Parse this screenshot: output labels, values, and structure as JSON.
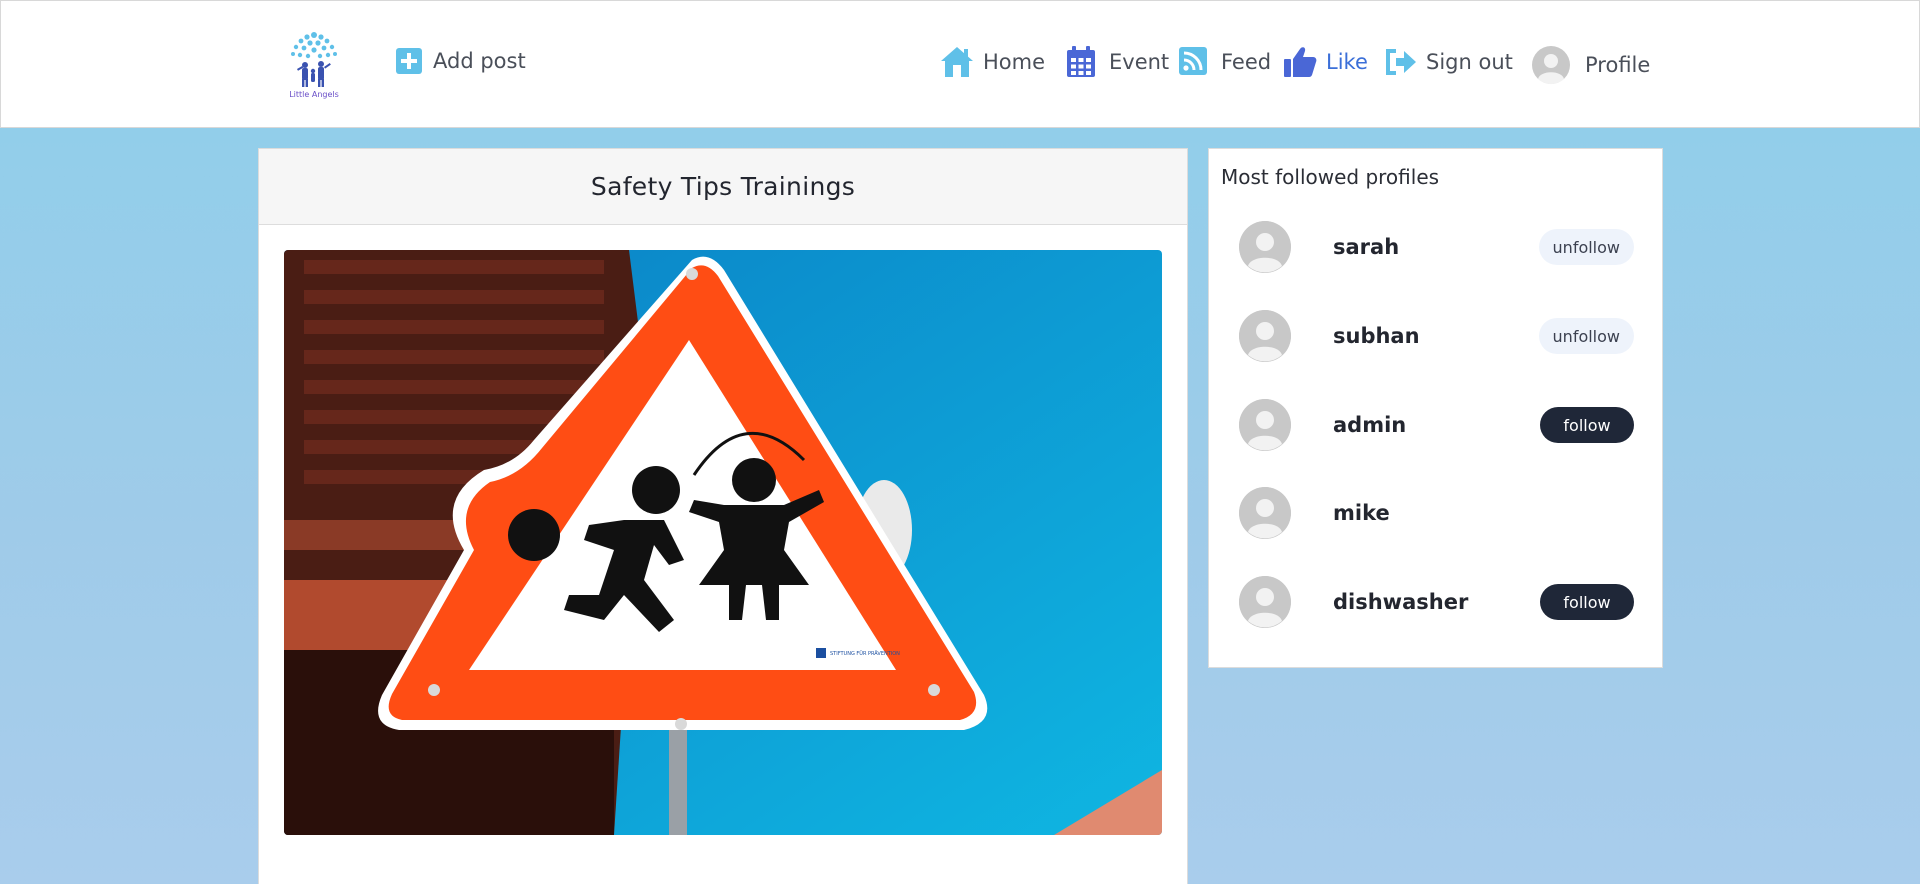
{
  "header": {
    "logo_text": "Little Angels",
    "add_post_label": "Add post",
    "nav": [
      {
        "label": "Home",
        "icon": "home-icon"
      },
      {
        "label": "Event",
        "icon": "calendar-icon"
      },
      {
        "label": "Feed",
        "icon": "rss-icon"
      },
      {
        "label": "Like",
        "icon": "thumbs-up-icon",
        "active": true
      },
      {
        "label": "Sign out",
        "icon": "sign-out-icon"
      },
      {
        "label": "Profile",
        "icon": "avatar-icon"
      }
    ]
  },
  "post": {
    "title": "Safety Tips Trainings",
    "image_sign_text": "STIFTUNG FÜR PRÄVENTION"
  },
  "profiles": {
    "title": "Most followed profiles",
    "items": [
      {
        "name": "sarah",
        "action": "unfollow"
      },
      {
        "name": "subhan",
        "action": "unfollow"
      },
      {
        "name": "admin",
        "action": "follow"
      },
      {
        "name": "mike",
        "action": ""
      },
      {
        "name": "dishwasher",
        "action": "follow"
      }
    ]
  },
  "colors": {
    "accent": "#3b6fd8",
    "icon_blue": "#5fc0e8",
    "icon_indigo": "#4a67d6",
    "follow_bg": "#1f2738",
    "unfollow_bg": "#eef3fb",
    "page_bg": "#8ecfea"
  }
}
